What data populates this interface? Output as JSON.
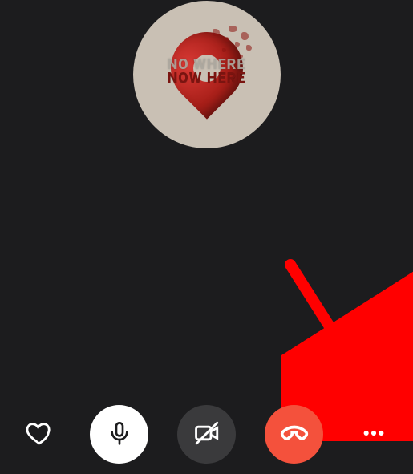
{
  "avatar": {
    "text_line1": "NO WHERE",
    "text_line2": "NOW HERE",
    "bg_color": "#c9c0b4",
    "pin_color": "#b0201a"
  },
  "call_controls": {
    "react_label": "React",
    "mic_label": "Mute",
    "video_label": "Toggle camera (off)",
    "end_label": "End call",
    "more_label": "More options",
    "end_color": "#f4513c"
  },
  "annotation": {
    "hint": "arrow pointing to more-options"
  }
}
